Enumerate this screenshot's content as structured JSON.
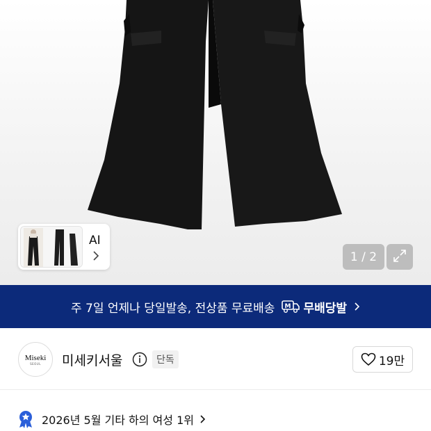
{
  "gallery": {
    "thumbnail_label": "AI",
    "page_counter": "1 / 2"
  },
  "shipping_banner": {
    "message": "주 7일 언제나 당일발송, 전상품 무료배송",
    "badge_text": "무배당발",
    "background_color": "#0c2a7a"
  },
  "brand": {
    "logo_text": "Miseki",
    "logo_subtext": "SEOUL",
    "name": "미세키서울",
    "tag": "단독",
    "like_count": "19만"
  },
  "ranking": {
    "text": "2026년 5월 기타 하의 여성 1위",
    "icon": "rank-medal-icon",
    "icon_color": "#2b5fd9"
  }
}
